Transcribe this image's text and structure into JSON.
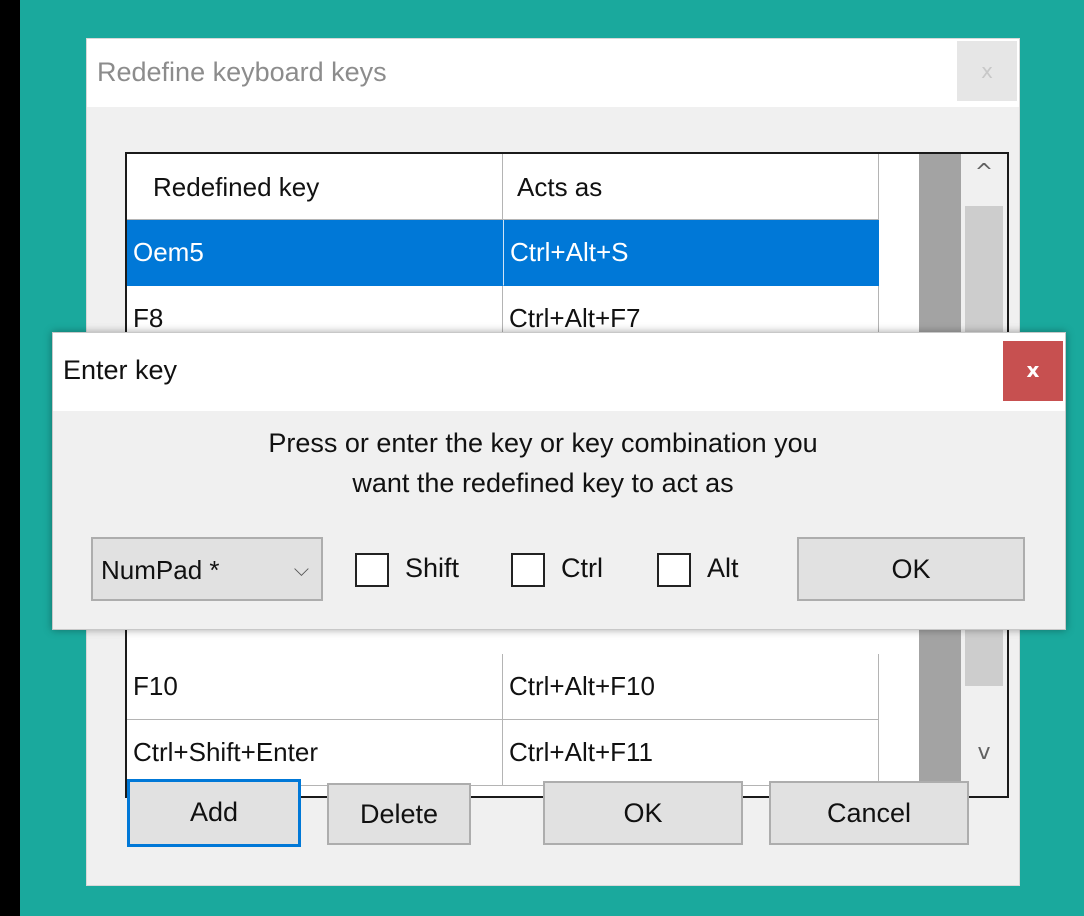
{
  "colors": {
    "desktop": "#1aa99d",
    "selection": "#0078d7",
    "close_button_active": "#c75050"
  },
  "main_dialog": {
    "title": "Redefine keyboard keys",
    "close_icon": "x",
    "table": {
      "columns": [
        "Redefined key",
        "Acts as"
      ],
      "rows": [
        {
          "key": "Oem5",
          "acts_as": "Ctrl+Alt+S",
          "selected": true
        },
        {
          "key": "F8",
          "acts_as": "Ctrl+Alt+F7",
          "selected": false
        },
        {
          "key": "F10",
          "acts_as": "Ctrl+Alt+F10",
          "selected": false
        },
        {
          "key": "Ctrl+Shift+Enter",
          "acts_as": "Ctrl+Alt+F11",
          "selected": false
        }
      ],
      "scroll_up_icon": "^",
      "scroll_down_icon": "v"
    },
    "buttons": {
      "add": "Add",
      "delete": "Delete",
      "ok": "OK",
      "cancel": "Cancel"
    }
  },
  "enter_key_dialog": {
    "title": "Enter key",
    "close_icon": "x",
    "prompt_line1": "Press or enter the key or key combination you",
    "prompt_line2": "want the redefined key to act as",
    "key_select": {
      "value": "NumPad *",
      "arrow_icon": "⌵"
    },
    "modifiers": [
      {
        "label": "Shift",
        "checked": false
      },
      {
        "label": "Ctrl",
        "checked": false
      },
      {
        "label": "Alt",
        "checked": false
      }
    ],
    "ok": "OK"
  }
}
